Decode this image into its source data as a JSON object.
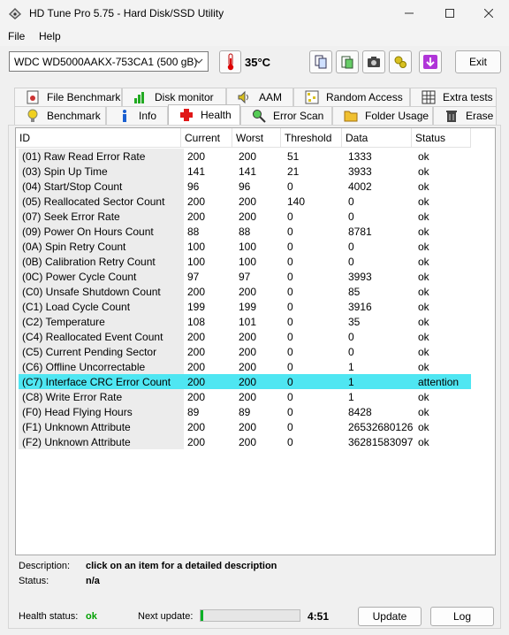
{
  "window": {
    "title": "HD Tune Pro 5.75 - Hard Disk/SSD Utility"
  },
  "menu": [
    "File",
    "Help"
  ],
  "toolbar": {
    "drive": "WDC WD5000AAKX-753CA1 (500 gB)",
    "temperature": "35°C",
    "exit_label": "Exit"
  },
  "tabs_top": [
    "File Benchmark",
    "Disk monitor",
    "AAM",
    "Random Access",
    "Extra tests"
  ],
  "tabs_bottom": [
    "Benchmark",
    "Info",
    "Health",
    "Error Scan",
    "Folder Usage",
    "Erase"
  ],
  "active_tab": "Health",
  "table": {
    "columns": [
      "ID",
      "Current",
      "Worst",
      "Threshold",
      "Data",
      "Status"
    ],
    "rows": [
      [
        "(01) Raw Read Error Rate",
        "200",
        "200",
        "51",
        "1333",
        "ok"
      ],
      [
        "(03) Spin Up Time",
        "141",
        "141",
        "21",
        "3933",
        "ok"
      ],
      [
        "(04) Start/Stop Count",
        "96",
        "96",
        "0",
        "4002",
        "ok"
      ],
      [
        "(05) Reallocated Sector Count",
        "200",
        "200",
        "140",
        "0",
        "ok"
      ],
      [
        "(07) Seek Error Rate",
        "200",
        "200",
        "0",
        "0",
        "ok"
      ],
      [
        "(09) Power On Hours Count",
        "88",
        "88",
        "0",
        "8781",
        "ok"
      ],
      [
        "(0A) Spin Retry Count",
        "100",
        "100",
        "0",
        "0",
        "ok"
      ],
      [
        "(0B) Calibration Retry Count",
        "100",
        "100",
        "0",
        "0",
        "ok"
      ],
      [
        "(0C) Power Cycle Count",
        "97",
        "97",
        "0",
        "3993",
        "ok"
      ],
      [
        "(C0) Unsafe Shutdown Count",
        "200",
        "200",
        "0",
        "85",
        "ok"
      ],
      [
        "(C1) Load Cycle Count",
        "199",
        "199",
        "0",
        "3916",
        "ok"
      ],
      [
        "(C2) Temperature",
        "108",
        "101",
        "0",
        "35",
        "ok"
      ],
      [
        "(C4) Reallocated Event Count",
        "200",
        "200",
        "0",
        "0",
        "ok"
      ],
      [
        "(C5) Current Pending Sector",
        "200",
        "200",
        "0",
        "0",
        "ok"
      ],
      [
        "(C6) Offline Uncorrectable",
        "200",
        "200",
        "0",
        "1",
        "ok"
      ],
      [
        "(C7) Interface CRC Error Count",
        "200",
        "200",
        "0",
        "1",
        "attention"
      ],
      [
        "(C8) Write Error Rate",
        "200",
        "200",
        "0",
        "1",
        "ok"
      ],
      [
        "(F0) Head Flying Hours",
        "89",
        "89",
        "0",
        "8428",
        "ok"
      ],
      [
        "(F1) Unknown Attribute",
        "200",
        "200",
        "0",
        "26532680126",
        "ok"
      ],
      [
        "(F2) Unknown Attribute",
        "200",
        "200",
        "0",
        "36281583097",
        "ok"
      ]
    ],
    "selected_row": 15
  },
  "details": {
    "description_label": "Description:",
    "description_value": "click on an item for a detailed description",
    "status_label": "Status:",
    "status_value": "n/a"
  },
  "footer": {
    "health_label": "Health status:",
    "health_value": "ok",
    "next_update_label": "Next update:",
    "next_update_time": "4:51",
    "progress_fraction": 0.03,
    "update_label": "Update",
    "log_label": "Log"
  },
  "colors": {
    "selected_row": "#4fe6f2",
    "health_ok": "#00a000",
    "progress": "#06b025"
  }
}
